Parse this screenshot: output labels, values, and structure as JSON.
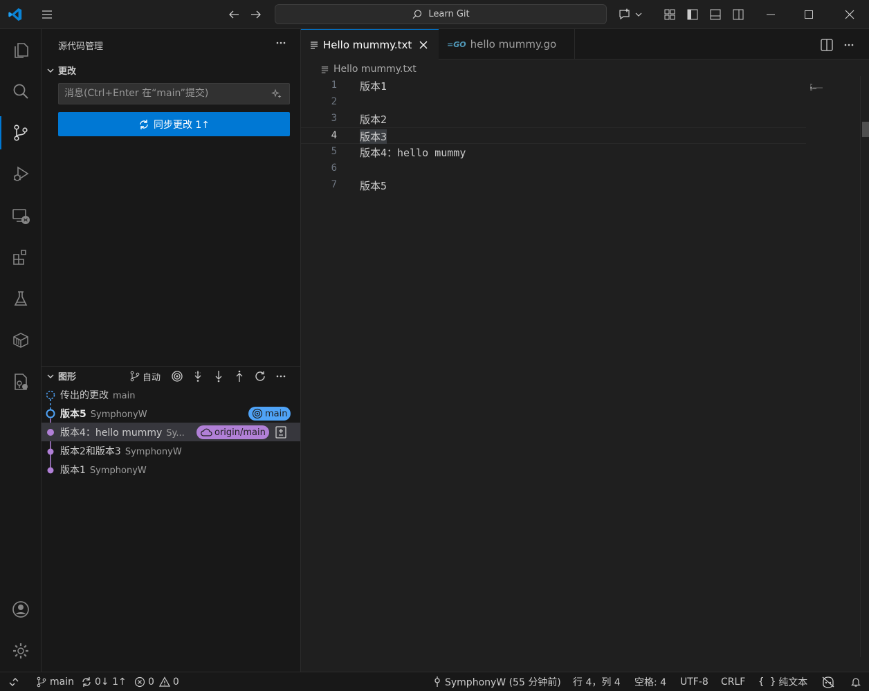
{
  "titlebar": {
    "search_text": "Learn Git"
  },
  "sidebar": {
    "title": "源代码管理",
    "changes_header": "更改",
    "commit_placeholder": "消息(Ctrl+Enter 在“main”提交)",
    "sync_button": "同步更改 1↑",
    "graph_header": "图形",
    "graph_auto": "自动",
    "graph_rows": [
      {
        "label": "传出的更改",
        "author": "main"
      },
      {
        "label": "版本5",
        "author": "SymphonyW",
        "badge": "main"
      },
      {
        "label": "版本4：hello mummy",
        "author": "Sy...",
        "badge": "origin/main"
      },
      {
        "label": "版本2和版本3",
        "author": "SymphonyW"
      },
      {
        "label": "版本1",
        "author": "SymphonyW"
      }
    ]
  },
  "editor": {
    "tabs": [
      {
        "label": "Hello mummy.txt",
        "active": true
      },
      {
        "label": "hello mummy.go",
        "active": false
      }
    ],
    "breadcrumb": "Hello mummy.txt",
    "lines": [
      {
        "num": "1",
        "text": "版本1"
      },
      {
        "num": "2",
        "text": ""
      },
      {
        "num": "3",
        "text": "版本2"
      },
      {
        "num": "4",
        "text": "版本3"
      },
      {
        "num": "5",
        "text": "版本4：hello mummy"
      },
      {
        "num": "6",
        "text": ""
      },
      {
        "num": "7",
        "text": "版本5"
      }
    ]
  },
  "statusbar": {
    "branch": "main",
    "sync": "0↓ 1↑",
    "errors": "0",
    "warnings": "0",
    "blame": "SymphonyW (55 分钟前)",
    "position": "行 4，列 4",
    "indent": "空格: 4",
    "encoding": "UTF-8",
    "eol": "CRLF",
    "language": "纯文本"
  },
  "colors": {
    "accent": "#0078d4",
    "graph_blue": "#4fa3f7",
    "graph_purple": "#b180d7",
    "badge_main": "#4fa3f7",
    "badge_origin": "#b180d7"
  }
}
